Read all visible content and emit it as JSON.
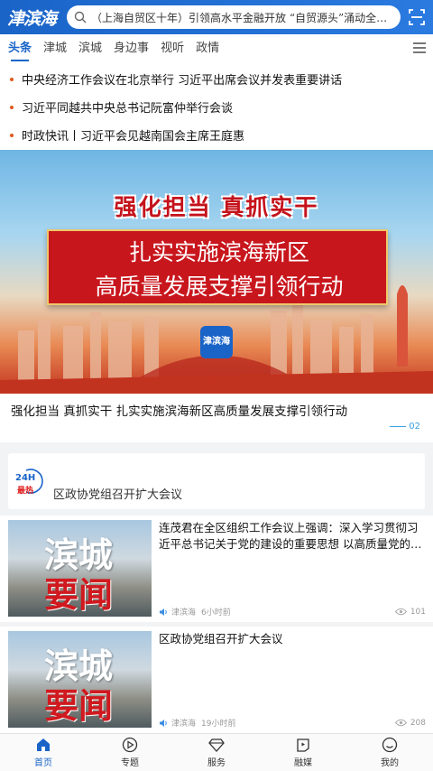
{
  "app": {
    "logo": "津滨海"
  },
  "search": {
    "text": "（上海自贸区十年）引领高水平金融开放 “自贸源头”涌动全球“…"
  },
  "tabs": [
    "头条",
    "津城",
    "滨城",
    "身边事",
    "视听",
    "政情"
  ],
  "headlines": [
    "中央经济工作会议在北京举行 习近平出席会议并发表重要讲话",
    "习近平同越共中央总书记阮富仲举行会谈",
    "时政快讯丨习近平会见越南国会主席王庭惠"
  ],
  "banner": {
    "title": "强化担当 真抓实干",
    "line1": "扎实实施滨海新区",
    "line2": "高质量发展支撑引领行动",
    "logo": "津滨海",
    "caption": "强化担当 真抓实干 扎实实施滨海新区高质量发展支撑引领行动",
    "page": "02"
  },
  "hot": {
    "badge_top": "24H",
    "badge_bottom": "最热",
    "text": "区政协党组召开扩大会议"
  },
  "news": [
    {
      "title": "连茂君在全区组织工作会议上强调：深入学习贯彻习近平总书记关于党的建设的重要思想 以高质量党的建…",
      "thumb_line1": "滨城",
      "thumb_line2": "要闻",
      "source": "津滨海",
      "time": "6小时前",
      "views": "101"
    },
    {
      "title": "区政协党组召开扩大会议",
      "thumb_line1": "滨城",
      "thumb_line2": "要闻",
      "source": "津滨海",
      "time": "19小时前",
      "views": "208"
    }
  ],
  "nav": [
    {
      "label": "首页",
      "icon": "home-icon"
    },
    {
      "label": "专题",
      "icon": "play-circle-icon"
    },
    {
      "label": "服务",
      "icon": "diamond-icon"
    },
    {
      "label": "融媒",
      "icon": "media-icon"
    },
    {
      "label": "我的",
      "icon": "profile-icon"
    }
  ],
  "colors": {
    "primary": "#1a64c8",
    "accent": "#e05a1c",
    "banner_red": "#c8161d"
  }
}
